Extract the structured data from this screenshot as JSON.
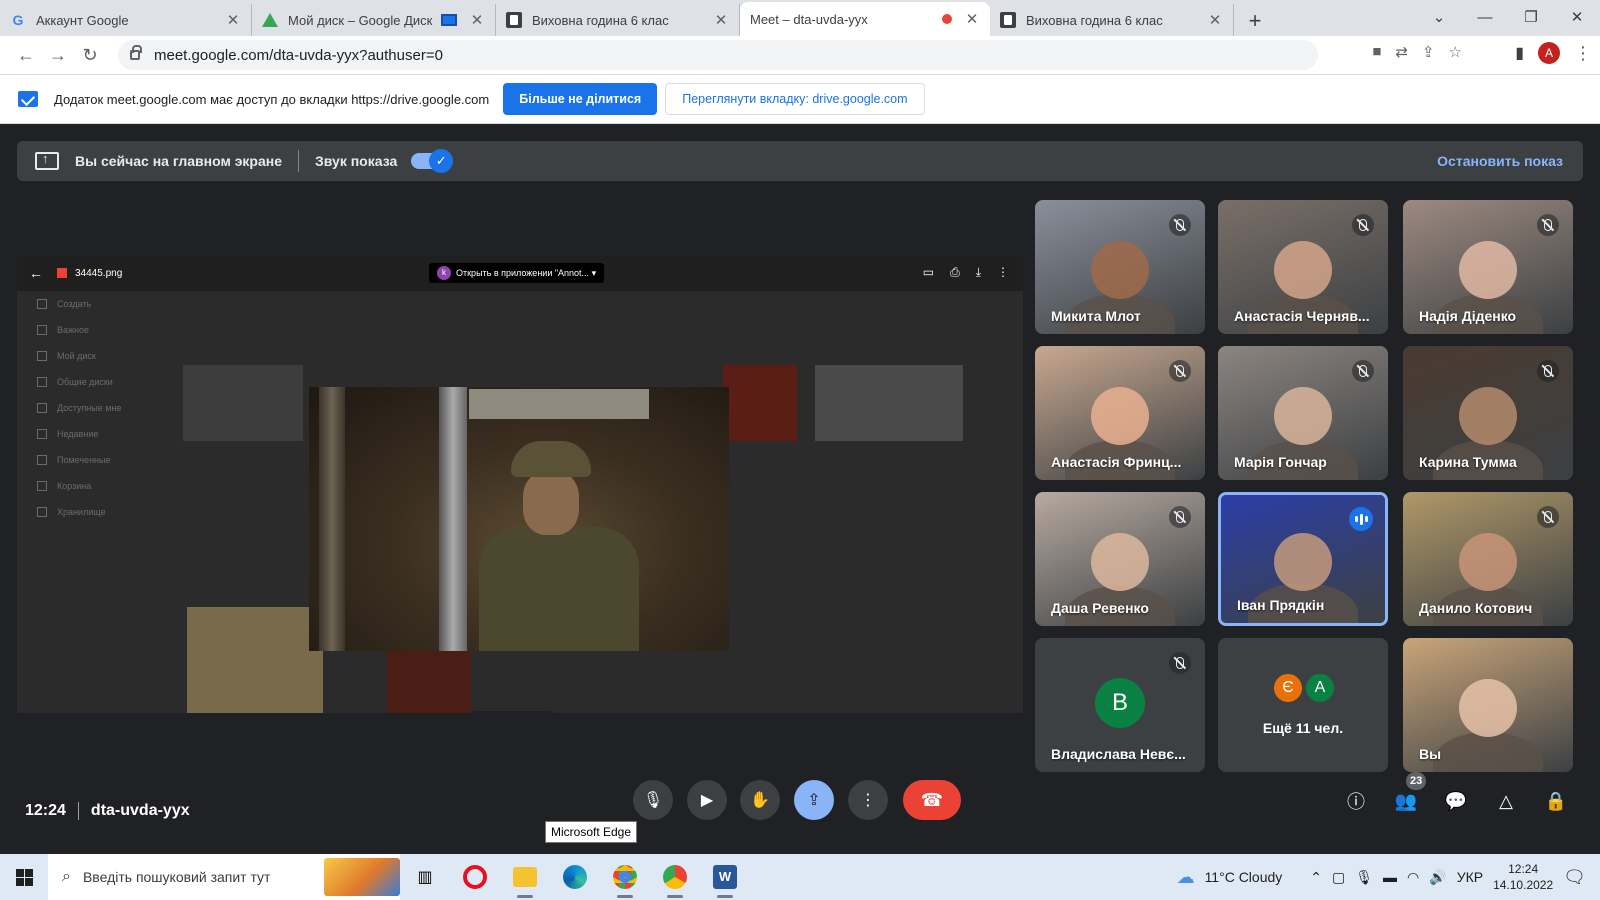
{
  "browser": {
    "tabs": [
      {
        "title": "Аккаунт Google",
        "icon": "google-icon"
      },
      {
        "title": "Мой диск – Google Диск",
        "icon": "drive-icon"
      },
      {
        "title": "Виховна година 6 клас",
        "icon": "docs-icon"
      },
      {
        "title": "Meet – dta-uvda-yyx",
        "icon": "meet-icon",
        "active": true
      },
      {
        "title": "Виховна година 6 клас",
        "icon": "docs-icon"
      }
    ],
    "url": "meet.google.com/dta-uvda-yyx?authuser=0",
    "profile_initial": "A"
  },
  "infobar": {
    "message": "Додаток meet.google.com має доступ до вкладки https://drive.google.com",
    "stop_sharing_label": "Більше не ділитися",
    "view_tab_label": "Переглянути вкладку: drive.google.com"
  },
  "presenting": {
    "status": "Вы сейчас на главном экране",
    "audio_label": "Звук показа",
    "audio_on": true,
    "stop_label": "Остановить показ"
  },
  "shared_screen": {
    "file_name": "34445.png",
    "open_in_app": "Открыть в приложении \"Annot...",
    "sidebar": [
      "Создать",
      "Важное",
      "Мой диск",
      "Общие диски",
      "Доступные мне",
      "Недавние",
      "Помеченные",
      "Корзина",
      "Хранилище"
    ]
  },
  "participants": [
    {
      "name": "Микита Млот",
      "muted": true,
      "bg": "#8a8f9a",
      "skin": "#a06a4a"
    },
    {
      "name": "Анастасія Черняв...",
      "muted": true,
      "bg": "#7a6f68",
      "skin": "#d4a58a"
    },
    {
      "name": "Надія Діденко",
      "muted": true,
      "bg": "#9d8a80",
      "skin": "#e0b9a3"
    },
    {
      "name": "Анастасія Фринц...",
      "muted": true,
      "bg": "#c8a890",
      "skin": "#e9b08f"
    },
    {
      "name": "Марія Гончар",
      "muted": true,
      "bg": "#8c8580",
      "skin": "#d8b49a"
    },
    {
      "name": "Карина Тумма",
      "muted": true,
      "bg": "#4a3b30",
      "skin": "#b38a6c"
    },
    {
      "name": "Даша Ревенко",
      "muted": true,
      "bg": "#b7aaa0",
      "skin": "#dcb79e"
    },
    {
      "name": "Іван Прядкін",
      "muted": false,
      "speaking": true,
      "bg": "#2b3ea8",
      "skin": "#c49a7c"
    },
    {
      "name": "Данило Котович",
      "muted": true,
      "bg": "#b09868",
      "skin": "#c89478"
    },
    {
      "name": "Владислава Невє...",
      "muted": true,
      "avatar_letter": "В",
      "avatar_color": "#0b8043"
    },
    {
      "name": "Ещё 11 чел.",
      "more": [
        "Є",
        "А"
      ],
      "more_colors": [
        "#e8710a",
        "#0b8043"
      ]
    },
    {
      "name": "Вы",
      "muted": false,
      "bg": "#c9a57a",
      "skin": "#e6c2a8"
    }
  ],
  "meeting": {
    "time": "12:24",
    "code": "dta-uvda-yyx",
    "participant_count": "23",
    "tooltip": "Microsoft Edge"
  },
  "taskbar": {
    "search_placeholder": "Введіть пошуковий запит тут",
    "weather": "11°C  Cloudy",
    "lang": "УКР",
    "time": "12:24",
    "date": "14.10.2022"
  }
}
